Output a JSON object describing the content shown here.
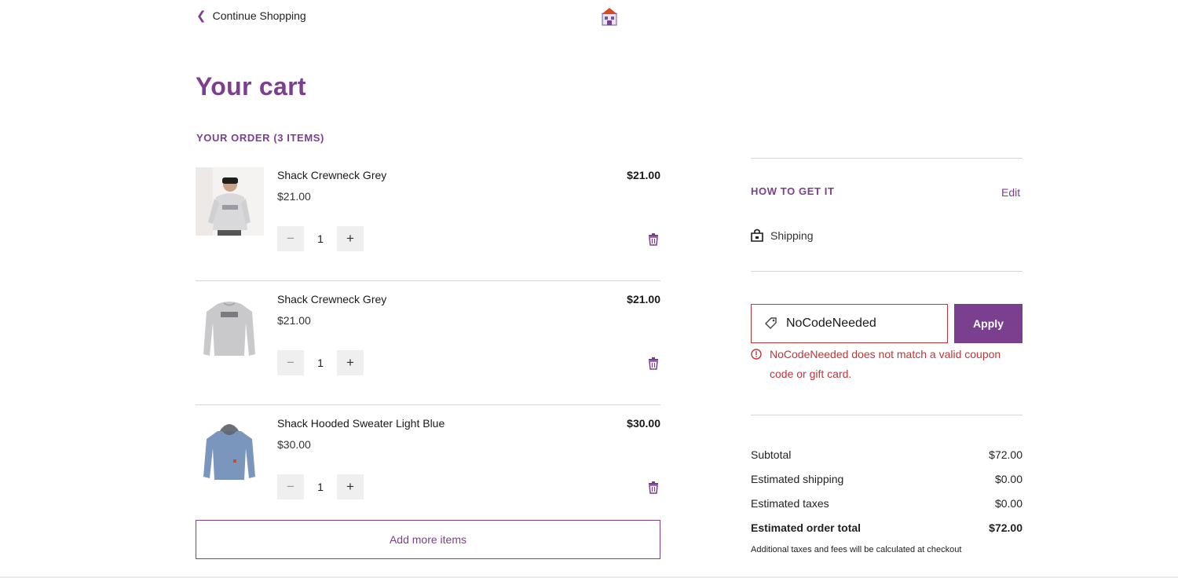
{
  "header": {
    "continue_label": "Continue Shopping"
  },
  "page": {
    "title": "Your cart",
    "order_label": "YOUR ORDER (3 ITEMS)"
  },
  "items": [
    {
      "name": "Shack Crewneck Grey",
      "unit_price": "$21.00",
      "line_total": "$21.00",
      "quantity": "1",
      "minus": "−",
      "plus": "+"
    },
    {
      "name": "Shack Crewneck Grey",
      "unit_price": "$21.00",
      "line_total": "$21.00",
      "quantity": "1",
      "minus": "−",
      "plus": "+"
    },
    {
      "name": "Shack Hooded Sweater Light Blue",
      "unit_price": "$30.00",
      "line_total": "$30.00",
      "quantity": "1",
      "minus": "−",
      "plus": "+"
    }
  ],
  "add_more_label": "Add more items",
  "fulfillment": {
    "heading": "HOW TO GET IT",
    "edit_label": "Edit",
    "method": "Shipping"
  },
  "coupon": {
    "value": "NoCodeNeeded",
    "apply_label": "Apply",
    "error": "NoCodeNeeded does not match a valid coupon code or gift card."
  },
  "summary": {
    "subtotal_label": "Subtotal",
    "subtotal": "$72.00",
    "shipping_label": "Estimated shipping",
    "shipping": "$0.00",
    "taxes_label": "Estimated taxes",
    "taxes": "$0.00",
    "total_label": "Estimated order total",
    "total": "$72.00",
    "note": "Additional taxes and fees will be calculated at checkout"
  },
  "colors": {
    "brand": "#7b3f8f",
    "error": "#c0353a"
  }
}
